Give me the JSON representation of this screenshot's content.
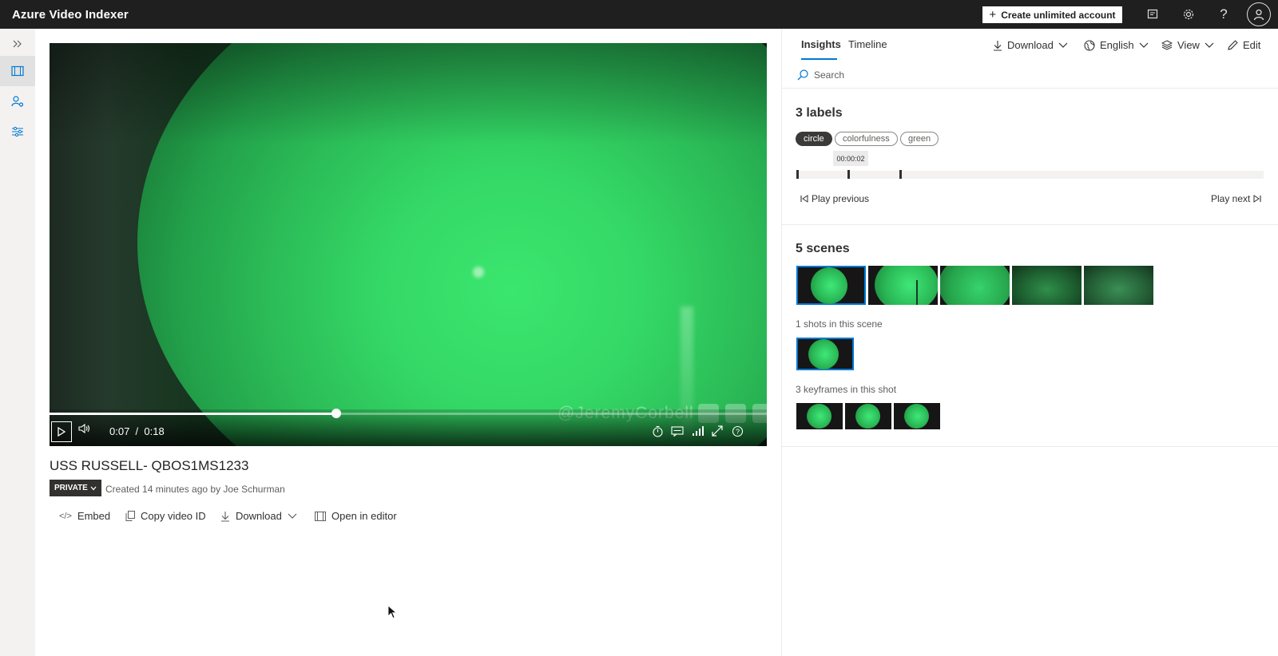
{
  "app": {
    "title": "Azure Video Indexer"
  },
  "header": {
    "create_account_label": "Create unlimited account",
    "icons": [
      "notes-icon",
      "gear-icon",
      "help-icon",
      "avatar-icon"
    ]
  },
  "leftnav": {
    "icons": [
      "expand-icon",
      "film-icon",
      "people-settings-icon",
      "sliders-icon"
    ]
  },
  "video": {
    "current_time": "0:07",
    "separator": "/",
    "duration": "0:18",
    "progress_fraction": 0.4,
    "watermark": "@JeremyCorbell",
    "title": "USS RUSSELL- QBOS1MS1233",
    "privacy": "PRIVATE",
    "created": "Created 14 minutes ago by Joe Schurman",
    "actions": {
      "embed": "Embed",
      "copy_id": "Copy video ID",
      "download": "Download",
      "open_editor": "Open in editor"
    }
  },
  "insights": {
    "tabs": {
      "insights": "Insights",
      "timeline": "Timeline"
    },
    "toolbar": {
      "download": "Download",
      "language": "English",
      "view": "View",
      "edit": "Edit"
    },
    "search_placeholder": "Search",
    "labels": {
      "heading": "3 labels",
      "chips": [
        "circle",
        "colorfulness",
        "green"
      ],
      "selected": "circle",
      "tooltip": "00:00:02",
      "tick_fractions": [
        0.0,
        0.11,
        0.22
      ],
      "play_previous": "Play previous",
      "play_next": "Play next"
    },
    "scenes": {
      "heading": "5 scenes",
      "count": 5,
      "shots_label": "1 shots in this scene",
      "keyframes_label": "3 keyframes in this shot"
    }
  },
  "colors": {
    "topbar": "#1f1f1f",
    "accent": "#0078d4",
    "nightvision_green": "#34d866"
  }
}
